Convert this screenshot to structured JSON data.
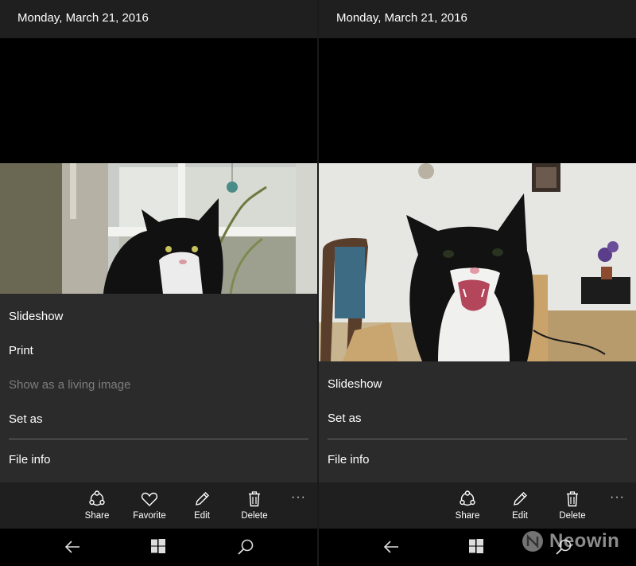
{
  "left": {
    "header": {
      "date": "Monday, March 21, 2016"
    },
    "menu": [
      {
        "label": "Slideshow",
        "enabled": true
      },
      {
        "label": "Print",
        "enabled": true
      },
      {
        "label": "Show as a living image",
        "enabled": false
      },
      {
        "label": "Set as",
        "enabled": true
      },
      {
        "label": "File info",
        "enabled": true
      }
    ],
    "appbar": {
      "share": "Share",
      "favorite": "Favorite",
      "edit": "Edit",
      "delete": "Delete",
      "more": "···"
    }
  },
  "right": {
    "header": {
      "date": "Monday, March 21, 2016"
    },
    "menu": [
      {
        "label": "Slideshow",
        "enabled": true
      },
      {
        "label": "Set as",
        "enabled": true
      },
      {
        "label": "File info",
        "enabled": true
      }
    ],
    "appbar": {
      "share": "Share",
      "edit": "Edit",
      "delete": "Delete",
      "more": "···"
    }
  },
  "navbar": {
    "icons": [
      "back-arrow-icon",
      "windows-logo-icon",
      "search-icon"
    ]
  },
  "watermark": {
    "text": "Neowin"
  },
  "colors": {
    "header": "#1f1f1f",
    "menu": "#2b2b2b",
    "disabled_text": "#7d7d7d"
  }
}
